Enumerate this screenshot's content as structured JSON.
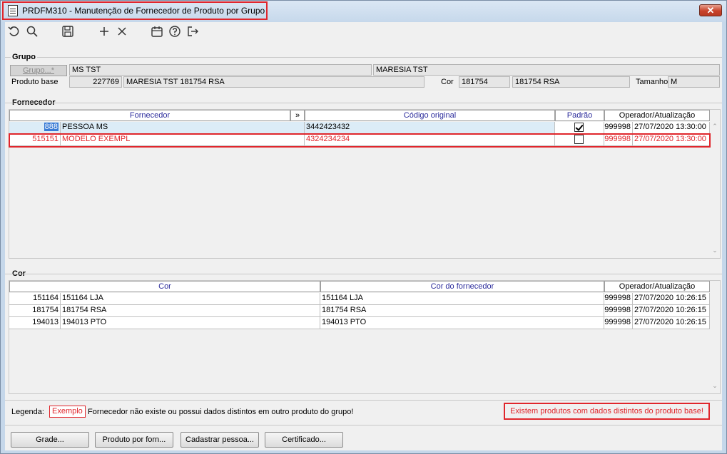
{
  "window": {
    "title": "PRDFM310 - Manutenção de Fornecedor de Produto por Grupo",
    "close_label": "✕"
  },
  "toolbar": {
    "icons": [
      "undo-icon",
      "search-icon",
      "save-icon",
      "add-icon",
      "delete-icon",
      "calendar-icon",
      "help-icon",
      "exit-icon"
    ]
  },
  "grupo": {
    "section_label": "Grupo",
    "grupo_button": "Grupo...*",
    "grupo_code": "MS TST",
    "grupo_name": "MARESIA TST",
    "produto_base_label": "Produto base",
    "produto_base_code": "227769",
    "produto_base_name": "MARESIA TST 181754 RSA",
    "cor_label": "Cor",
    "cor_code": "181754",
    "cor_name": "181754 RSA",
    "tamanho_label": "Tamanho",
    "tamanho_value": "M"
  },
  "fornecedor": {
    "section_label": "Fornecedor",
    "columns": {
      "fornecedor": "Fornecedor",
      "expand": "»",
      "codigo_original": "Código original",
      "padrao": "Padrão",
      "operador": "Operador/Atualização"
    },
    "rows": [
      {
        "code": "888",
        "name": "PESSOA MS",
        "codigo_original": "3442423432",
        "padrao": true,
        "operador": "999998",
        "data": "27/07/2020 13:30:00"
      },
      {
        "code": "515151",
        "name": "MODELO EXEMPL",
        "codigo_original": "4324234234",
        "padrao": false,
        "operador": "999998",
        "data": "27/07/2020 13:30:00"
      }
    ]
  },
  "cor": {
    "section_label": "Cor",
    "columns": {
      "cor": "Cor",
      "cor_fornecedor": "Cor do fornecedor",
      "operador": "Operador/Atualização"
    },
    "rows": [
      {
        "code": "151164",
        "name": "151164 LJA",
        "cor_fornecedor": "151164 LJA",
        "operador": "999998",
        "data": "27/07/2020 10:26:15"
      },
      {
        "code": "181754",
        "name": "181754 RSA",
        "cor_fornecedor": "181754 RSA",
        "operador": "999998",
        "data": "27/07/2020 10:26:15"
      },
      {
        "code": "194013",
        "name": "194013 PTO",
        "cor_fornecedor": "194013 PTO",
        "operador": "999998",
        "data": "27/07/2020 10:26:15"
      }
    ]
  },
  "legenda": {
    "label": "Legenda:",
    "sample": "Exemplo",
    "text": "Fornecedor não existe ou possui dados distintos em outro produto do grupo!",
    "warning": "Existem produtos com dados distintos do produto base!"
  },
  "buttons": {
    "grade": "Grade...",
    "produto_por_forn": "Produto por forn...",
    "cadastrar_pessoa": "Cadastrar pessoa...",
    "certificado": "Certificado..."
  },
  "colors": {
    "highlight_red": "#e0262c",
    "header_text_blue": "#2c2c9c",
    "selected_row": "#dcecf7"
  }
}
